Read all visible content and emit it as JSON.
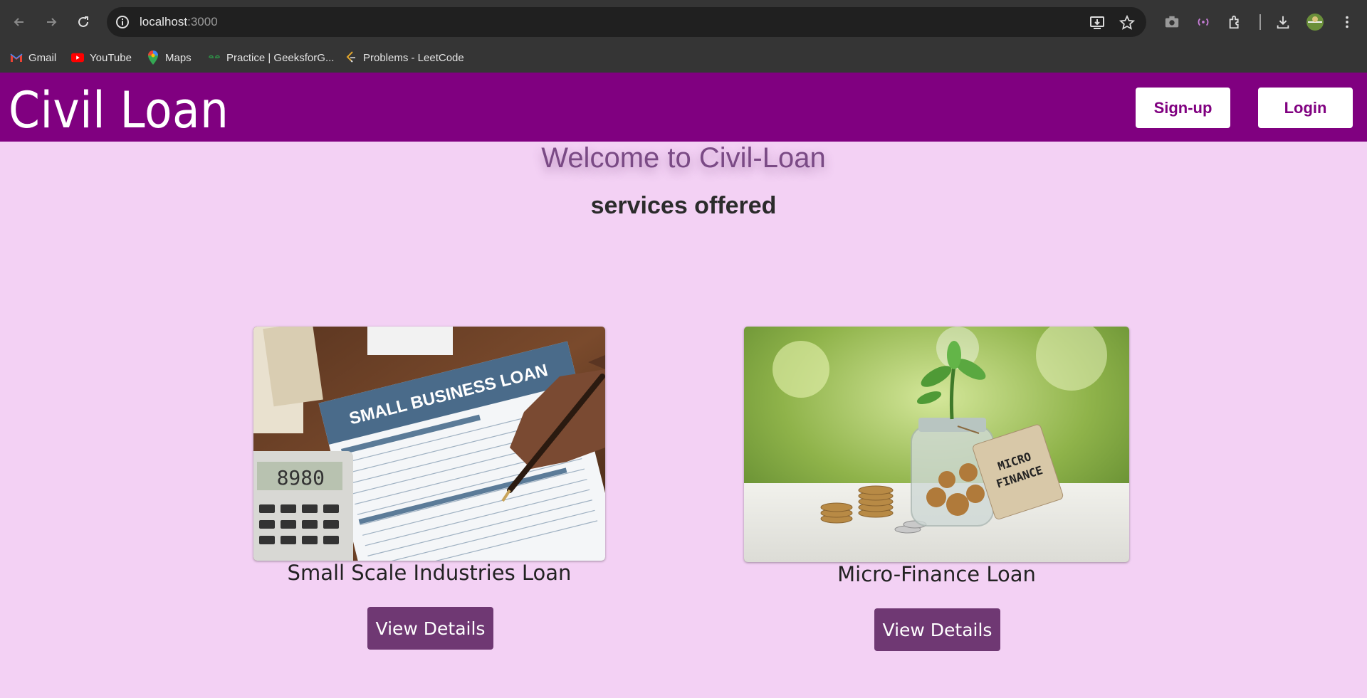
{
  "browser": {
    "url_host": "localhost",
    "url_port": ":3000",
    "bookmarks": [
      {
        "label": "Gmail",
        "icon": "gmail-icon"
      },
      {
        "label": "YouTube",
        "icon": "youtube-icon"
      },
      {
        "label": "Maps",
        "icon": "maps-icon"
      },
      {
        "label": "Practice | GeeksforG...",
        "icon": "geeksforgeeks-icon"
      },
      {
        "label": "Problems - LeetCode",
        "icon": "leetcode-icon"
      }
    ]
  },
  "header": {
    "brand": "Civil Loan",
    "signup_label": "Sign-up",
    "login_label": "Login",
    "color": "#800080"
  },
  "main": {
    "welcome": "Welcome to Civil-Loan",
    "services_heading": "services offered",
    "cards": [
      {
        "title": "Small Scale Industries Loan",
        "button": "View Details",
        "image_text": "SMALL BUSINESS LOAN"
      },
      {
        "title": "Micro-Finance Loan",
        "button": "View Details",
        "image_text": "MICRO FINANCE"
      }
    ]
  }
}
